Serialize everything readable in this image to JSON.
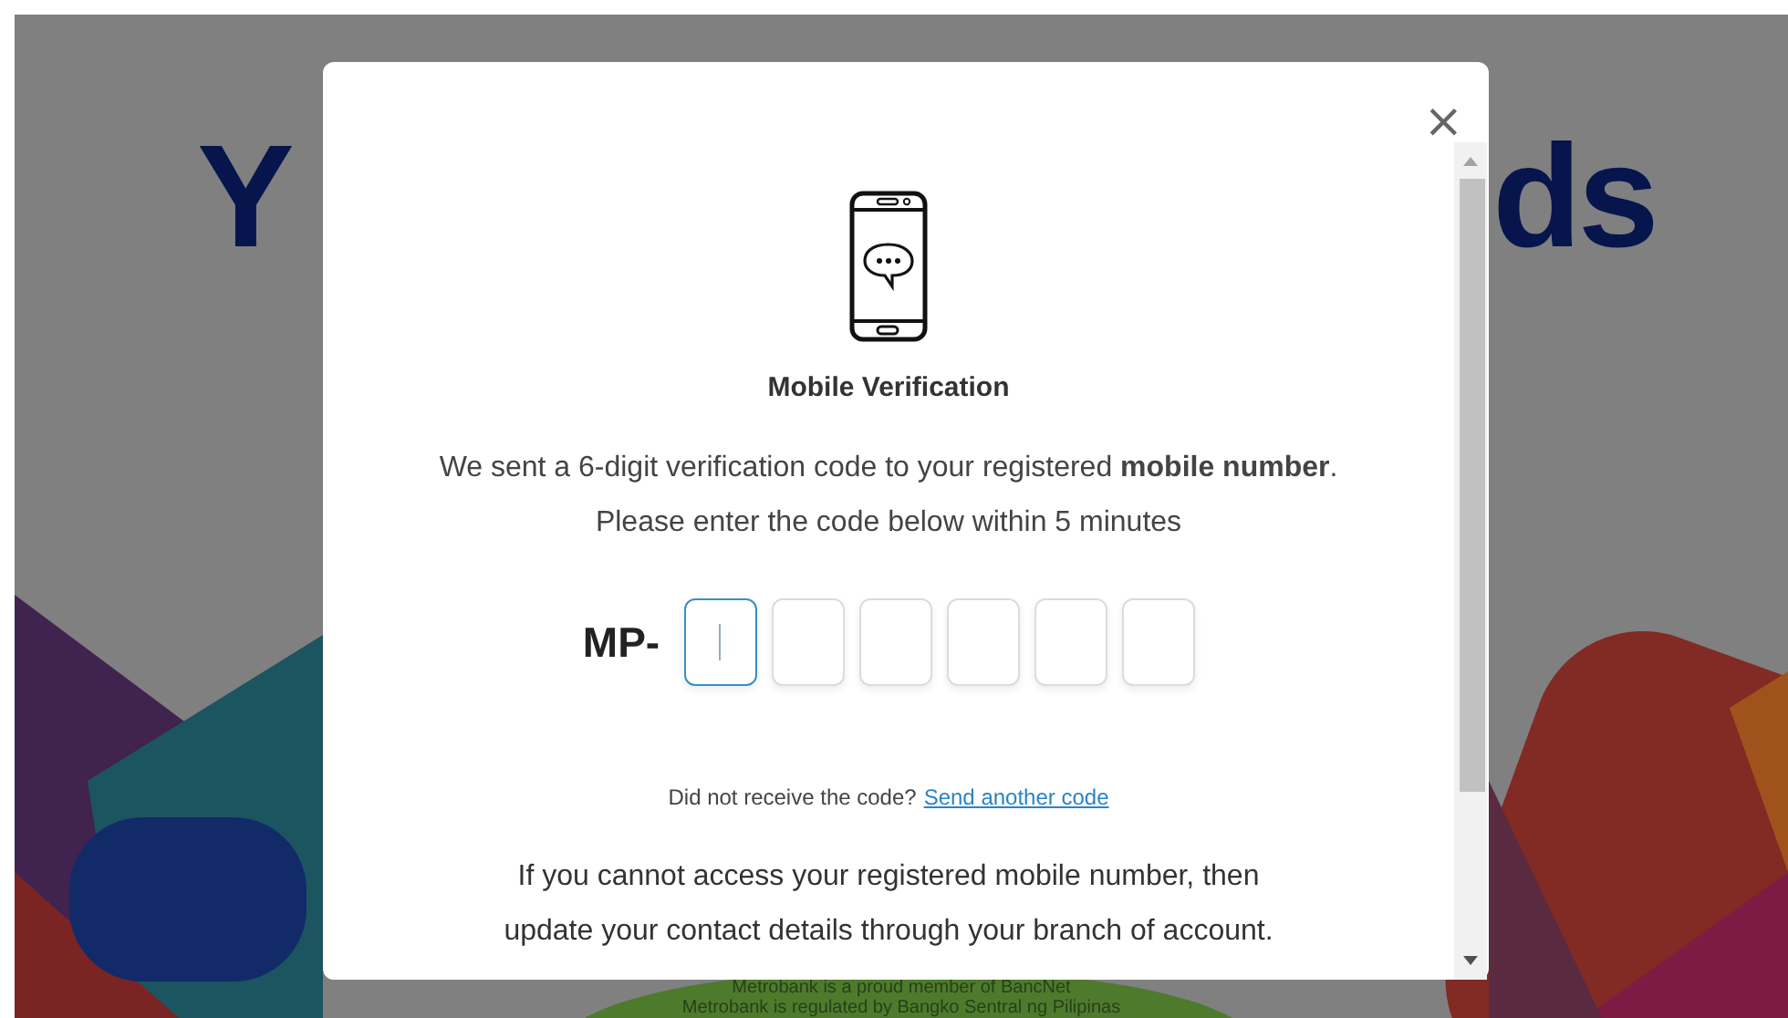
{
  "page": {
    "heading_start": "Y",
    "heading_end": "ds",
    "footer": [
      "Metrobank is a proud member of BancNet",
      "Metrobank is regulated by Bangko Sentral ng Pilipinas"
    ]
  },
  "dialog": {
    "close": "×",
    "title": "Mobile Verification",
    "message": "We sent a 6-digit verification code to your registered **mobile number**.",
    "instruction": "Please enter the code below within 5 minutes",
    "code_prefix": "MP-",
    "code_fields": [
      {
        "focused": true
      },
      {
        "focused": false
      },
      {
        "focused": false
      },
      {
        "focused": false
      },
      {
        "focused": false
      },
      {
        "focused": false
      }
    ],
    "resend_prompt": "Did not receive the code?",
    "resend_link": "Send another code",
    "note": "If you cannot access your registered mobile number, then update your contact details through your branch of account."
  }
}
